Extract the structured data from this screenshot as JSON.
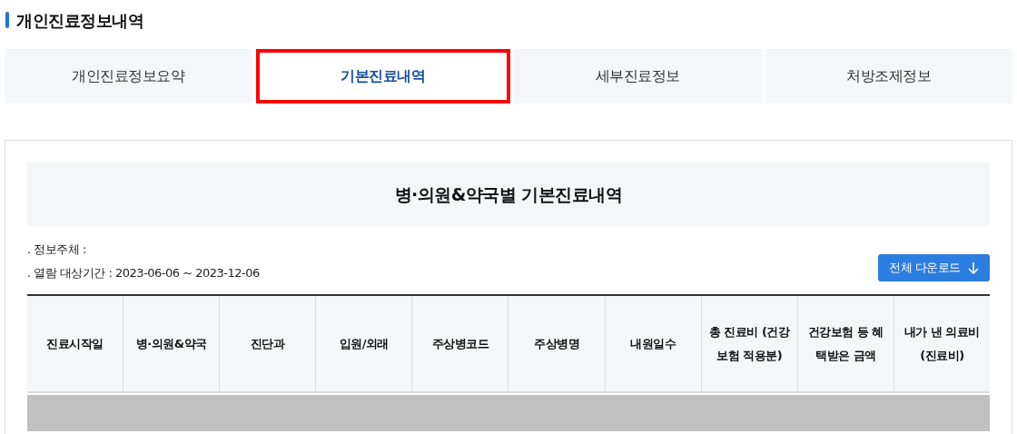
{
  "page_title": "개인진료정보내역",
  "tabs": [
    {
      "label": "개인진료정보요약",
      "selected": false
    },
    {
      "label": "기본진료내역",
      "selected": true
    },
    {
      "label": "세부진료정보",
      "selected": false
    },
    {
      "label": "처방조제정보",
      "selected": false
    }
  ],
  "section": {
    "heading": "병·의원&약국별 기본진료내역",
    "info": [
      ". 정보주체 :",
      ". 열람 대상기간 : 2023-06-06 ~ 2023-12-06"
    ],
    "download_button": "전체 다운로드",
    "table": {
      "columns": [
        "진료시작일",
        "병·의원&약국",
        "진단과",
        "입원/외래",
        "주상병코드",
        "주상병명",
        "내원일수",
        "총 진료비 (건강보험 적용분)",
        "건강보험 등 혜택받은 금액",
        "내가 낸 의료비 (진료비)"
      ]
    }
  }
}
